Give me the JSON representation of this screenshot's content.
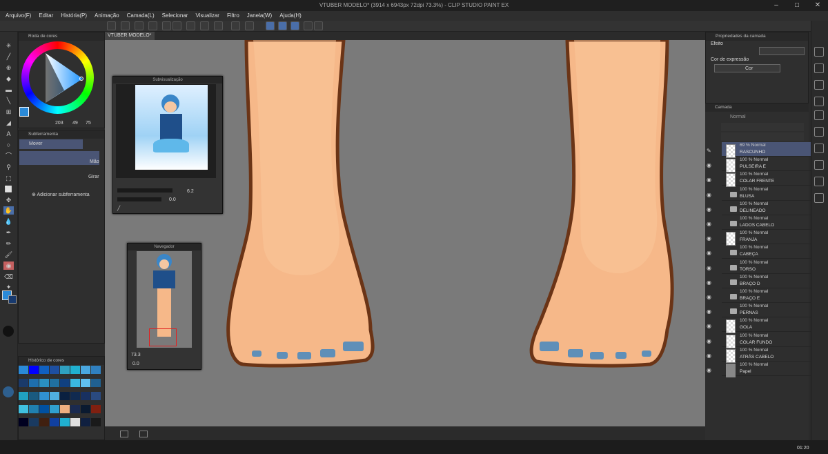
{
  "app": {
    "title": "VTUBER MODELO* (3914 x 6943px 72dpi 73.3%) - CLIP STUDIO PAINT EX",
    "tab": "VTUBER MODELO*"
  },
  "menu": [
    "Arquivo(F)",
    "Editar",
    "História(P)",
    "Animação",
    "Camada(L)",
    "Selecionar",
    "Visualizar",
    "Filtro",
    "Janela(W)",
    "Ajuda(H)"
  ],
  "color_wheel": {
    "title": "Roda de cores",
    "h": "203",
    "s": "49",
    "v": "75",
    "main_color": "#3b8fd6"
  },
  "subtool": {
    "title": "Subferramenta",
    "group": "Mover",
    "items": [
      "Mão",
      "Girar"
    ],
    "add": "Adicionar subferramenta"
  },
  "history": {
    "title": "Histórico de cores"
  },
  "subview": {
    "title": "Subvisualização",
    "zoom": "6.2",
    "angle": "0.0"
  },
  "navigator": {
    "title": "Navegador",
    "zoom": "73.3",
    "angle": "0.0"
  },
  "properties": {
    "title": "Propriedades da camada",
    "effect": "Efeito",
    "expr_label": "Cor de expressão",
    "expr_value": "Cor"
  },
  "layers": {
    "title": "Camada",
    "blend": "Normal",
    "items": [
      {
        "mode": "69 % Normal",
        "name": "RASCUNHO",
        "type": "layer",
        "selected": true
      },
      {
        "mode": "100 % Normal",
        "name": "PULSEIRA E",
        "type": "layer"
      },
      {
        "mode": "100 % Normal",
        "name": "COLAR FRENTE",
        "type": "layer"
      },
      {
        "mode": "100 % Normal",
        "name": "BLUSA",
        "type": "folder"
      },
      {
        "mode": "100 % Normal",
        "name": "DELINEADO",
        "type": "folder"
      },
      {
        "mode": "100 % Normal",
        "name": "LADOS CABELO",
        "type": "folder"
      },
      {
        "mode": "100 % Normal",
        "name": "FRANJA",
        "type": "layer"
      },
      {
        "mode": "100 % Normal",
        "name": "CABEÇA",
        "type": "folder"
      },
      {
        "mode": "100 % Normal",
        "name": "TORSO",
        "type": "folder"
      },
      {
        "mode": "100 % Normal",
        "name": "BRAÇO D",
        "type": "folder"
      },
      {
        "mode": "100 % Normal",
        "name": "BRAÇO E",
        "type": "folder"
      },
      {
        "mode": "100 % Normal",
        "name": "PERNAS",
        "type": "folder"
      },
      {
        "mode": "100 % Normal",
        "name": "GOLA",
        "type": "layer"
      },
      {
        "mode": "100 % Normal",
        "name": "COLAR FUNDO",
        "type": "layer"
      },
      {
        "mode": "100 % Normal",
        "name": "ATRÁS CABELO",
        "type": "layer"
      },
      {
        "mode": "100 % Normal",
        "name": "Papel",
        "type": "paper"
      }
    ]
  },
  "taskbar": {
    "time": "01:20"
  },
  "colors": {
    "accent": "#4a6ea8",
    "skin": "#f6b889",
    "outline": "#6b3416",
    "nail": "#5f8fb8"
  }
}
